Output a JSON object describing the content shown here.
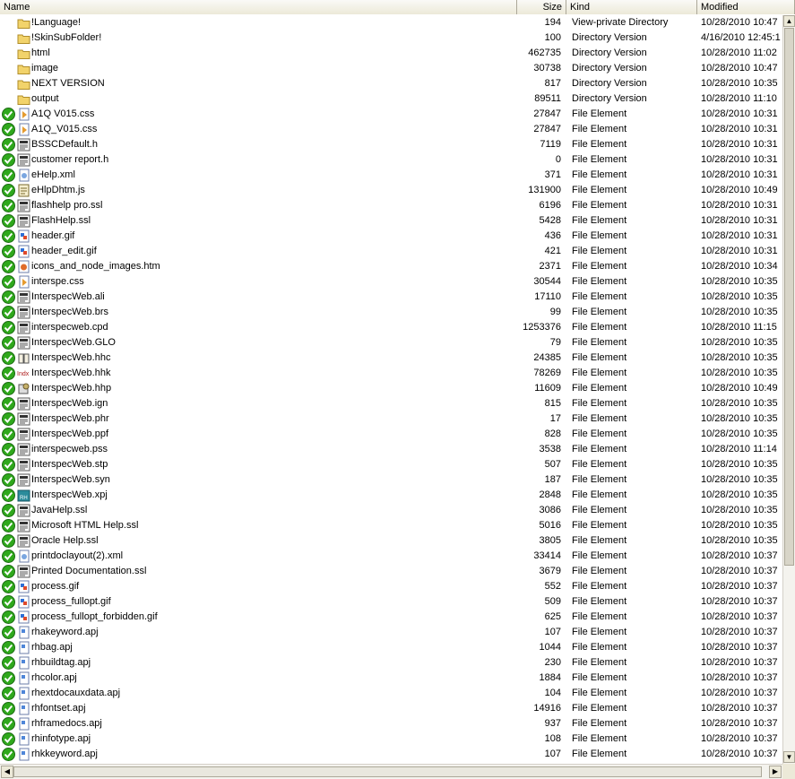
{
  "columns": {
    "name": "Name",
    "size": "Size",
    "kind": "Kind",
    "modified": "Modified"
  },
  "colors": {
    "check": "#2fa81c",
    "folder": "#f2d36b",
    "header_bg": "#ece9d8"
  },
  "rows": [
    {
      "check": false,
      "icon": "folder-icon",
      "name": "!Language!",
      "size": "194",
      "kind": "View-private Directory",
      "modified": "10/28/2010 10:47"
    },
    {
      "check": false,
      "icon": "folder-icon",
      "name": "!SkinSubFolder!",
      "size": "100",
      "kind": "Directory Version",
      "modified": "4/16/2010 12:45:1"
    },
    {
      "check": false,
      "icon": "folder-icon",
      "name": "html",
      "size": "462735",
      "kind": "Directory Version",
      "modified": "10/28/2010 11:02"
    },
    {
      "check": false,
      "icon": "folder-icon",
      "name": "image",
      "size": "30738",
      "kind": "Directory Version",
      "modified": "10/28/2010 10:47"
    },
    {
      "check": false,
      "icon": "folder-icon",
      "name": "NEXT VERSION",
      "size": "817",
      "kind": "Directory Version",
      "modified": "10/28/2010 10:35"
    },
    {
      "check": false,
      "icon": "folder-icon",
      "name": "output",
      "size": "89511",
      "kind": "Directory Version",
      "modified": "10/28/2010 11:10"
    },
    {
      "check": true,
      "icon": "css-file-icon",
      "name": "A1Q V015.css",
      "size": "27847",
      "kind": "File Element",
      "modified": "10/28/2010 10:31"
    },
    {
      "check": true,
      "icon": "css-file-icon",
      "name": "A1Q_V015.css",
      "size": "27847",
      "kind": "File Element",
      "modified": "10/28/2010 10:31"
    },
    {
      "check": true,
      "icon": "generic-file-icon",
      "name": "BSSCDefault.h",
      "size": "7119",
      "kind": "File Element",
      "modified": "10/28/2010 10:31"
    },
    {
      "check": true,
      "icon": "generic-file-icon",
      "name": "customer report.h",
      "size": "0",
      "kind": "File Element",
      "modified": "10/28/2010 10:31"
    },
    {
      "check": true,
      "icon": "xml-file-icon",
      "name": "eHelp.xml",
      "size": "371",
      "kind": "File Element",
      "modified": "10/28/2010 10:31"
    },
    {
      "check": true,
      "icon": "script-file-icon",
      "name": "eHlpDhtm.js",
      "size": "131900",
      "kind": "File Element",
      "modified": "10/28/2010 10:49"
    },
    {
      "check": true,
      "icon": "generic-file-icon",
      "name": "flashhelp pro.ssl",
      "size": "6196",
      "kind": "File Element",
      "modified": "10/28/2010 10:31"
    },
    {
      "check": true,
      "icon": "generic-file-icon",
      "name": "FlashHelp.ssl",
      "size": "5428",
      "kind": "File Element",
      "modified": "10/28/2010 10:31"
    },
    {
      "check": true,
      "icon": "image-file-icon",
      "name": "header.gif",
      "size": "436",
      "kind": "File Element",
      "modified": "10/28/2010 10:31"
    },
    {
      "check": true,
      "icon": "image-file-icon",
      "name": "header_edit.gif",
      "size": "421",
      "kind": "File Element",
      "modified": "10/28/2010 10:31"
    },
    {
      "check": true,
      "icon": "html-file-icon",
      "name": "icons_and_node_images.htm",
      "size": "2371",
      "kind": "File Element",
      "modified": "10/28/2010 10:34"
    },
    {
      "check": true,
      "icon": "css-file-icon",
      "name": "interspe.css",
      "size": "30544",
      "kind": "File Element",
      "modified": "10/28/2010 10:35"
    },
    {
      "check": true,
      "icon": "generic-file-icon",
      "name": "InterspecWeb.ali",
      "size": "17110",
      "kind": "File Element",
      "modified": "10/28/2010 10:35"
    },
    {
      "check": true,
      "icon": "generic-file-icon",
      "name": "InterspecWeb.brs",
      "size": "99",
      "kind": "File Element",
      "modified": "10/28/2010 10:35"
    },
    {
      "check": true,
      "icon": "generic-file-icon",
      "name": "interspecweb.cpd",
      "size": "1253376",
      "kind": "File Element",
      "modified": "10/28/2010 11:15"
    },
    {
      "check": true,
      "icon": "generic-file-icon",
      "name": "InterspecWeb.GLO",
      "size": "79",
      "kind": "File Element",
      "modified": "10/28/2010 10:35"
    },
    {
      "check": true,
      "icon": "book-file-icon",
      "name": "InterspecWeb.hhc",
      "size": "24385",
      "kind": "File Element",
      "modified": "10/28/2010 10:35"
    },
    {
      "check": true,
      "icon": "index-file-icon",
      "name": "InterspecWeb.hhk",
      "size": "78269",
      "kind": "File Element",
      "modified": "10/28/2010 10:35"
    },
    {
      "check": true,
      "icon": "project-file-icon",
      "name": "InterspecWeb.hhp",
      "size": "11609",
      "kind": "File Element",
      "modified": "10/28/2010 10:49"
    },
    {
      "check": true,
      "icon": "generic-file-icon",
      "name": "InterspecWeb.ign",
      "size": "815",
      "kind": "File Element",
      "modified": "10/28/2010 10:35"
    },
    {
      "check": true,
      "icon": "generic-file-icon",
      "name": "InterspecWeb.phr",
      "size": "17",
      "kind": "File Element",
      "modified": "10/28/2010 10:35"
    },
    {
      "check": true,
      "icon": "generic-file-icon",
      "name": "InterspecWeb.ppf",
      "size": "828",
      "kind": "File Element",
      "modified": "10/28/2010 10:35"
    },
    {
      "check": true,
      "icon": "generic-file-icon",
      "name": "interspecweb.pss",
      "size": "3538",
      "kind": "File Element",
      "modified": "10/28/2010 11:14"
    },
    {
      "check": true,
      "icon": "generic-file-icon",
      "name": "InterspecWeb.stp",
      "size": "507",
      "kind": "File Element",
      "modified": "10/28/2010 10:35"
    },
    {
      "check": true,
      "icon": "generic-file-icon",
      "name": "InterspecWeb.syn",
      "size": "187",
      "kind": "File Element",
      "modified": "10/28/2010 10:35"
    },
    {
      "check": true,
      "icon": "robohelp-project-icon",
      "name": "InterspecWeb.xpj",
      "size": "2848",
      "kind": "File Element",
      "modified": "10/28/2010 10:35"
    },
    {
      "check": true,
      "icon": "generic-file-icon",
      "name": "JavaHelp.ssl",
      "size": "3086",
      "kind": "File Element",
      "modified": "10/28/2010 10:35"
    },
    {
      "check": true,
      "icon": "generic-file-icon",
      "name": "Microsoft HTML Help.ssl",
      "size": "5016",
      "kind": "File Element",
      "modified": "10/28/2010 10:35"
    },
    {
      "check": true,
      "icon": "generic-file-icon",
      "name": "Oracle Help.ssl",
      "size": "3805",
      "kind": "File Element",
      "modified": "10/28/2010 10:35"
    },
    {
      "check": true,
      "icon": "xml-file-icon",
      "name": "printdoclayout(2).xml",
      "size": "33414",
      "kind": "File Element",
      "modified": "10/28/2010 10:37"
    },
    {
      "check": true,
      "icon": "generic-file-icon",
      "name": "Printed Documentation.ssl",
      "size": "3679",
      "kind": "File Element",
      "modified": "10/28/2010 10:37"
    },
    {
      "check": true,
      "icon": "image-file-icon",
      "name": "process.gif",
      "size": "552",
      "kind": "File Element",
      "modified": "10/28/2010 10:37"
    },
    {
      "check": true,
      "icon": "image-file-icon",
      "name": "process_fullopt.gif",
      "size": "509",
      "kind": "File Element",
      "modified": "10/28/2010 10:37"
    },
    {
      "check": true,
      "icon": "image-file-icon",
      "name": "process_fullopt_forbidden.gif",
      "size": "625",
      "kind": "File Element",
      "modified": "10/28/2010 10:37"
    },
    {
      "check": true,
      "icon": "apj-file-icon",
      "name": "rhakeyword.apj",
      "size": "107",
      "kind": "File Element",
      "modified": "10/28/2010 10:37"
    },
    {
      "check": true,
      "icon": "apj-file-icon",
      "name": "rhbag.apj",
      "size": "1044",
      "kind": "File Element",
      "modified": "10/28/2010 10:37"
    },
    {
      "check": true,
      "icon": "apj-file-icon",
      "name": "rhbuildtag.apj",
      "size": "230",
      "kind": "File Element",
      "modified": "10/28/2010 10:37"
    },
    {
      "check": true,
      "icon": "apj-file-icon",
      "name": "rhcolor.apj",
      "size": "1884",
      "kind": "File Element",
      "modified": "10/28/2010 10:37"
    },
    {
      "check": true,
      "icon": "apj-file-icon",
      "name": "rhextdocauxdata.apj",
      "size": "104",
      "kind": "File Element",
      "modified": "10/28/2010 10:37"
    },
    {
      "check": true,
      "icon": "apj-file-icon",
      "name": "rhfontset.apj",
      "size": "14916",
      "kind": "File Element",
      "modified": "10/28/2010 10:37"
    },
    {
      "check": true,
      "icon": "apj-file-icon",
      "name": "rhframedocs.apj",
      "size": "937",
      "kind": "File Element",
      "modified": "10/28/2010 10:37"
    },
    {
      "check": true,
      "icon": "apj-file-icon",
      "name": "rhinfotype.apj",
      "size": "108",
      "kind": "File Element",
      "modified": "10/28/2010 10:37"
    },
    {
      "check": true,
      "icon": "apj-file-icon",
      "name": "rhkkeyword.apj",
      "size": "107",
      "kind": "File Element",
      "modified": "10/28/2010 10:37"
    }
  ]
}
